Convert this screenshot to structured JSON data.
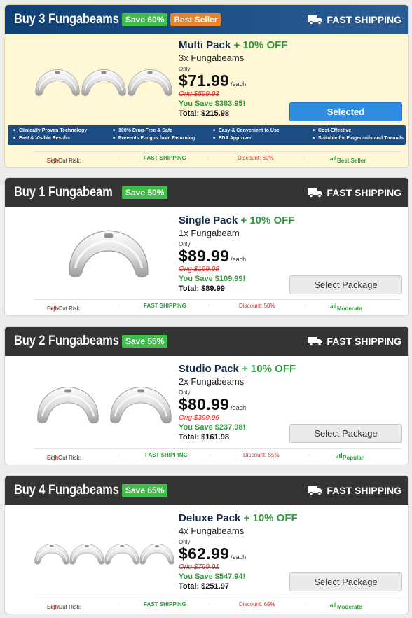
{
  "colors": {
    "selected_header": "#1a4a7e",
    "header": "#343434",
    "green": "#3fbf4a",
    "red": "#d1342f",
    "button_blue": "#2f8ce0"
  },
  "cards": [
    {
      "header_title": "Buy 3 Fungabeams",
      "save_badge": "Save 60%",
      "extra_badge": "Best Seller",
      "shipping": "FAST SHIPPING",
      "pack_name": "Multi Pack",
      "off_text": "+ 10% OFF",
      "qty": "3x Fungabeams",
      "only": "Only",
      "price": "$71.99",
      "each": "/each",
      "orig": "Orig $599.93",
      "you_save": "You Save $383.95!",
      "total": "Total: $215.98",
      "button": "Selected",
      "features": [
        "Clinically Proven Technology",
        "100% Drug-Free & Safe",
        "Easy & Convenient to Use",
        "Cost-Effective",
        "Fast & Visible Results",
        "Prevents Fungus from Returning",
        "FDA Approved",
        "Suitable for Fingernails and Toenails"
      ],
      "strip": {
        "risk_label": "Sell-Out Risk:",
        "risk_value": "High",
        "shipping": "FAST SHIPPING",
        "discount": "Discount: 60%",
        "tag": "Best Seller"
      }
    },
    {
      "header_title": "Buy 1 Fungabeam",
      "save_badge": "Save 50%",
      "shipping": "FAST SHIPPING",
      "pack_name": "Single Pack",
      "off_text": "+ 10% OFF",
      "qty": "1x Fungabeam",
      "only": "Only",
      "price": "$89.99",
      "each": "/each",
      "orig": "Orig $199.98",
      "you_save": "You Save $109.99!",
      "total": "Total: $89.99",
      "button": "Select Package",
      "strip": {
        "risk_label": "Sell-Out Risk:",
        "risk_value": "High",
        "shipping": "FAST SHIPPING",
        "discount": "Discount: 50%",
        "tag": "Moderate"
      }
    },
    {
      "header_title": "Buy 2 Fungabeams",
      "save_badge": "Save 55%",
      "shipping": "FAST SHIPPING",
      "pack_name": "Studio Pack",
      "off_text": "+ 10% OFF",
      "qty": "2x Fungabeams",
      "only": "Only",
      "price": "$80.99",
      "each": "/each",
      "orig": "Orig $399.96",
      "you_save": "You Save $237.98!",
      "total": "Total: $161.98",
      "button": "Select Package",
      "strip": {
        "risk_label": "Sell-Out Risk:",
        "risk_value": "High",
        "shipping": "FAST SHIPPING",
        "discount": "Discount: 55%",
        "tag": "Popular"
      }
    },
    {
      "header_title": "Buy 4 Fungabeams",
      "save_badge": "Save 65%",
      "shipping": "FAST SHIPPING",
      "pack_name": "Deluxe Pack",
      "off_text": "+ 10% OFF",
      "qty": "4x Fungabeams",
      "only": "Only",
      "price": "$62.99",
      "each": "/each",
      "orig": "Orig $799.91",
      "you_save": "You Save $547.94!",
      "total": "Total: $251.97",
      "button": "Select Package",
      "strip": {
        "risk_label": "Sell-Out Risk:",
        "risk_value": "High",
        "shipping": "FAST SHIPPING",
        "discount": "Discount: 65%",
        "tag": "Moderate"
      }
    }
  ]
}
